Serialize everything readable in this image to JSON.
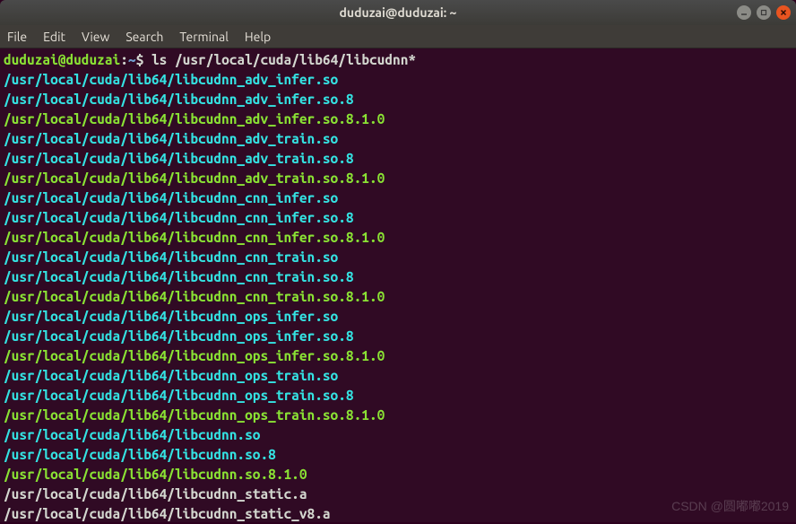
{
  "window": {
    "title": "duduzai@duduzai: ~"
  },
  "menu": {
    "items": [
      "File",
      "Edit",
      "View",
      "Search",
      "Terminal",
      "Help"
    ]
  },
  "prompt": {
    "user_host": "duduzai@duduzai",
    "colon": ":",
    "path": "~",
    "dollar": "$ ",
    "command": "ls /usr/local/cuda/lib64/libcudnn*"
  },
  "output_lines": [
    {
      "text": "/usr/local/cuda/lib64/libcudnn_adv_infer.so",
      "cls": "ln-cyan"
    },
    {
      "text": "/usr/local/cuda/lib64/libcudnn_adv_infer.so.8",
      "cls": "ln-cyan"
    },
    {
      "text": "/usr/local/cuda/lib64/libcudnn_adv_infer.so.8.1.0",
      "cls": "ln-green"
    },
    {
      "text": "/usr/local/cuda/lib64/libcudnn_adv_train.so",
      "cls": "ln-cyan"
    },
    {
      "text": "/usr/local/cuda/lib64/libcudnn_adv_train.so.8",
      "cls": "ln-cyan"
    },
    {
      "text": "/usr/local/cuda/lib64/libcudnn_adv_train.so.8.1.0",
      "cls": "ln-green"
    },
    {
      "text": "/usr/local/cuda/lib64/libcudnn_cnn_infer.so",
      "cls": "ln-cyan"
    },
    {
      "text": "/usr/local/cuda/lib64/libcudnn_cnn_infer.so.8",
      "cls": "ln-cyan"
    },
    {
      "text": "/usr/local/cuda/lib64/libcudnn_cnn_infer.so.8.1.0",
      "cls": "ln-green"
    },
    {
      "text": "/usr/local/cuda/lib64/libcudnn_cnn_train.so",
      "cls": "ln-cyan"
    },
    {
      "text": "/usr/local/cuda/lib64/libcudnn_cnn_train.so.8",
      "cls": "ln-cyan"
    },
    {
      "text": "/usr/local/cuda/lib64/libcudnn_cnn_train.so.8.1.0",
      "cls": "ln-green"
    },
    {
      "text": "/usr/local/cuda/lib64/libcudnn_ops_infer.so",
      "cls": "ln-cyan"
    },
    {
      "text": "/usr/local/cuda/lib64/libcudnn_ops_infer.so.8",
      "cls": "ln-cyan"
    },
    {
      "text": "/usr/local/cuda/lib64/libcudnn_ops_infer.so.8.1.0",
      "cls": "ln-green"
    },
    {
      "text": "/usr/local/cuda/lib64/libcudnn_ops_train.so",
      "cls": "ln-cyan"
    },
    {
      "text": "/usr/local/cuda/lib64/libcudnn_ops_train.so.8",
      "cls": "ln-cyan"
    },
    {
      "text": "/usr/local/cuda/lib64/libcudnn_ops_train.so.8.1.0",
      "cls": "ln-green"
    },
    {
      "text": "/usr/local/cuda/lib64/libcudnn.so",
      "cls": "ln-cyan"
    },
    {
      "text": "/usr/local/cuda/lib64/libcudnn.so.8",
      "cls": "ln-cyan"
    },
    {
      "text": "/usr/local/cuda/lib64/libcudnn.so.8.1.0",
      "cls": "ln-green"
    },
    {
      "text": "/usr/local/cuda/lib64/libcudnn_static.a",
      "cls": "ln-white"
    },
    {
      "text": "/usr/local/cuda/lib64/libcudnn_static_v8.a",
      "cls": "ln-white"
    }
  ],
  "watermark": "CSDN @圆嘟嘟2019"
}
